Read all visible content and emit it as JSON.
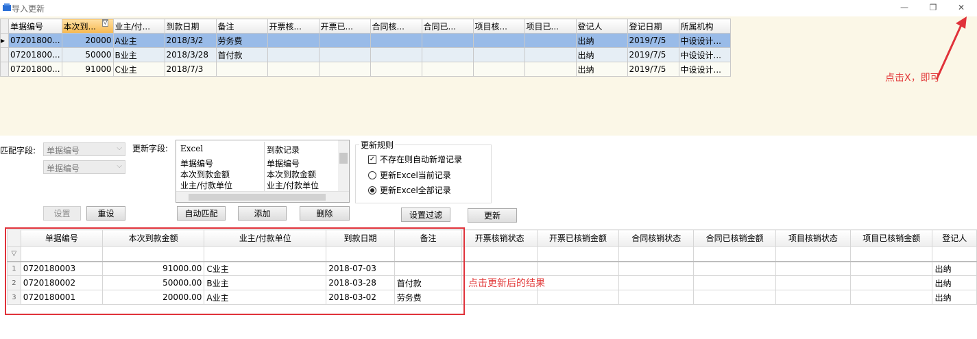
{
  "window": {
    "title": "导入更新",
    "minimize": "—",
    "restore": "❐",
    "close": "✕",
    "accent": "#2a6fd6"
  },
  "top_grid": {
    "columns": [
      "单据编号",
      "本次到...",
      "业主/付...",
      "到款日期",
      "备注",
      "开票核...",
      "开票已...",
      "合同核...",
      "合同已...",
      "项目核...",
      "项目已...",
      "登记人",
      "登记日期",
      "所属机构"
    ],
    "rows": [
      {
        "indicator": "▸",
        "cells": [
          "07201800...",
          "20000",
          "A业主",
          "2018/3/2",
          "劳务费",
          "",
          "",
          "",
          "",
          "",
          "",
          "出纳",
          "2019/7/5",
          "中设设计..."
        ]
      },
      {
        "indicator": "",
        "cells": [
          "07201800...",
          "50000",
          "B业主",
          "2018/3/28",
          "首付款",
          "",
          "",
          "",
          "",
          "",
          "",
          "出纳",
          "2019/7/5",
          "中设设计..."
        ]
      },
      {
        "indicator": "",
        "cells": [
          "07201800...",
          "91000",
          "C业主",
          "2018/7/3",
          "",
          "",
          "",
          "",
          "",
          "",
          "",
          "出纳",
          "2019/7/5",
          "中设设计..."
        ]
      }
    ],
    "selected_color": "#99bbe8",
    "sorted_header_color": "#f7b84f"
  },
  "match": {
    "label": "匹配字段:",
    "combo1": "单据编号",
    "combo2": "单据编号",
    "set_button": "设置",
    "reset_button": "重设"
  },
  "update_fields": {
    "label": "更新字段:",
    "header_excel": "Excel",
    "header_record": "到款记录",
    "items": [
      {
        "excel": "单据编号",
        "record": "单据编号"
      },
      {
        "excel": "本次到款金额",
        "record": "本次到款金额"
      },
      {
        "excel": "业主/付款单位",
        "record": "业主/付款单位"
      }
    ],
    "auto_button": "自动匹配",
    "add_button": "添加",
    "delete_button": "删除"
  },
  "rules": {
    "title": "更新规则",
    "checkbox_label": "不存在则自动新增记录",
    "checkbox_checked": true,
    "radio1_label": "更新Excel当前记录",
    "radio2_label": "更新Excel全部记录",
    "selected_radio": 2,
    "filter_button": "设置过滤",
    "update_button": "更新"
  },
  "bottom_grid": {
    "columns": [
      "单据编号",
      "本次到款金额",
      "业主/付款单位",
      "到款日期",
      "备注",
      "开票核销状态",
      "开票已核销金额",
      "合同核销状态",
      "合同已核销金额",
      "项目核销状态",
      "项目已核销金额",
      "登记人"
    ],
    "filter_icon": "▽",
    "rows": [
      {
        "indicator": "1",
        "cells": [
          "0720180003",
          "91000.00",
          "C业主",
          "2018-07-03",
          "",
          "",
          "",
          "",
          "",
          "",
          "",
          "出纳"
        ]
      },
      {
        "indicator": "2",
        "cells": [
          "0720180002",
          "50000.00",
          "B业主",
          "2018-03-28",
          "首付款",
          "",
          "",
          "",
          "",
          "",
          "",
          "出纳"
        ]
      },
      {
        "indicator": "3",
        "cells": [
          "0720180001",
          "20000.00",
          "A业主",
          "2018-03-02",
          "劳务费",
          "",
          "",
          "",
          "",
          "",
          "",
          "出纳"
        ]
      }
    ]
  },
  "annotations": {
    "close_hint": "点击X，即可",
    "result_hint": "点击更新后的结果",
    "color": "#e0323a"
  }
}
